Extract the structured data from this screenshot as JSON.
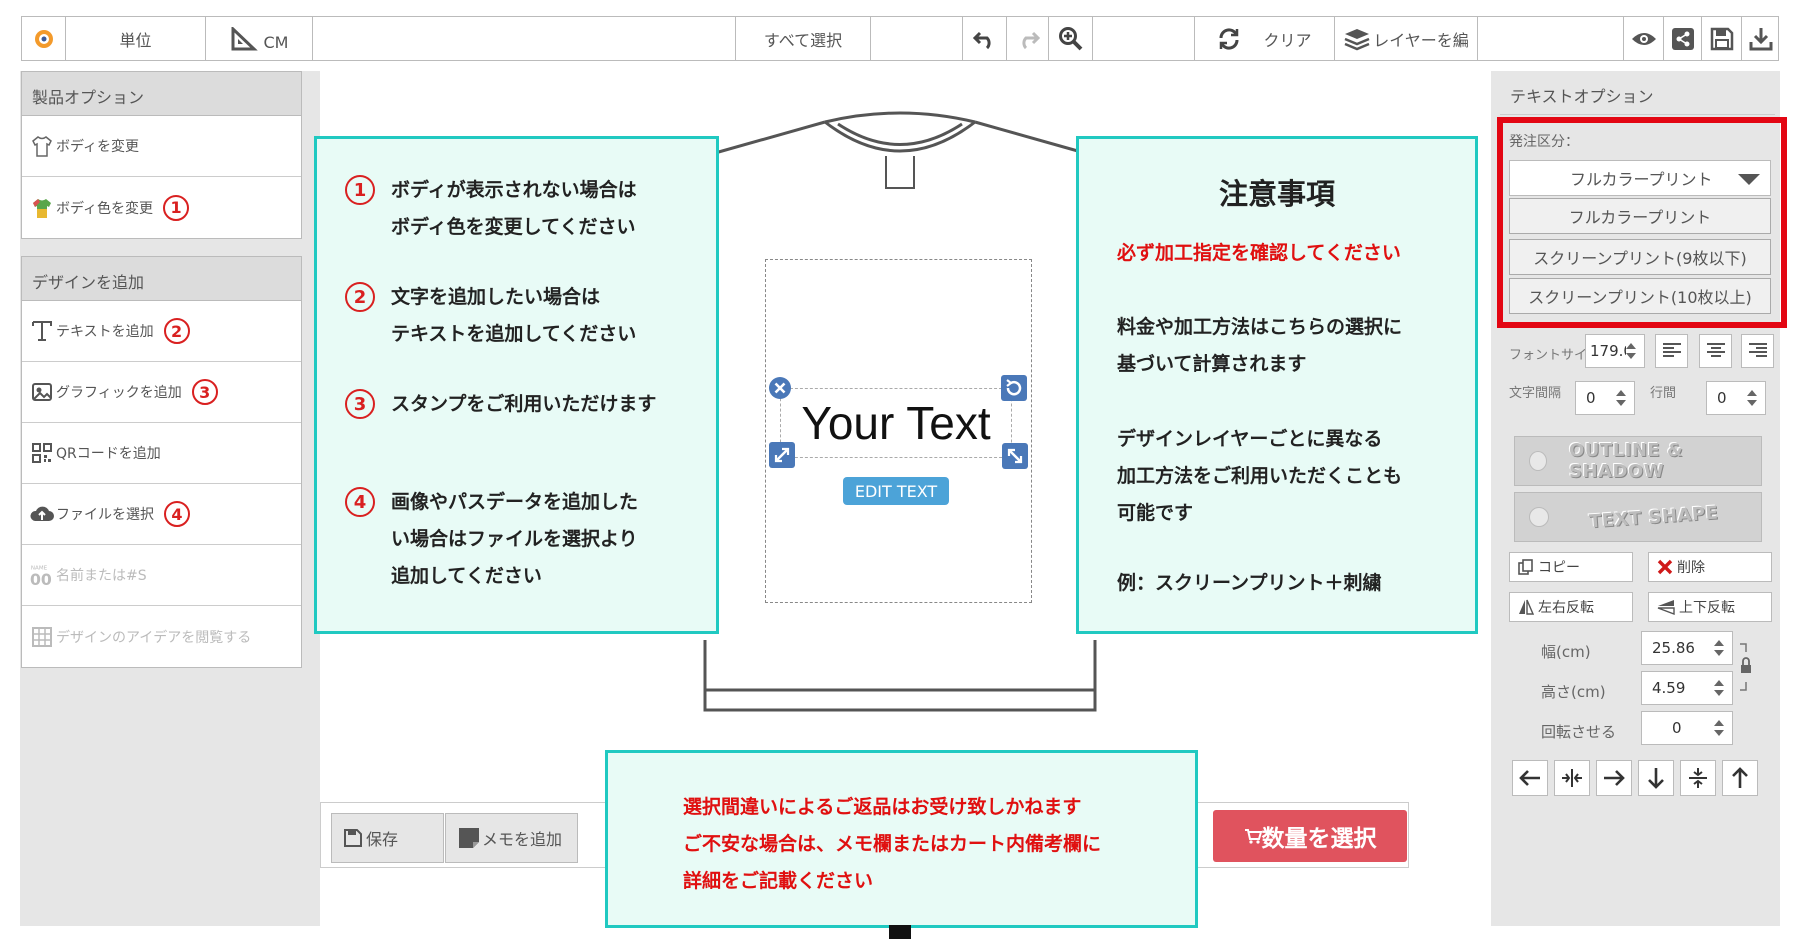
{
  "toolbar": {
    "unit_label": "単位",
    "unit_value": "CM",
    "select_all": "すべて選択",
    "clear": "クリア",
    "layers": "レイヤーを編"
  },
  "left_panel": {
    "product_options": {
      "title": "製品オプション",
      "items": [
        {
          "label": "ボディを変更",
          "icon": "tshirt-outline-icon"
        },
        {
          "label": "ボディ色を変更",
          "icon": "tshirt-color-icon",
          "number": "1"
        }
      ]
    },
    "add_design": {
      "title": "デザインを追加",
      "items": [
        {
          "label": "テキストを追加",
          "icon": "text-t-icon",
          "number": "2"
        },
        {
          "label": "グラフィックを追加",
          "icon": "graphic-icon",
          "number": "3"
        },
        {
          "label": "QRコードを追加",
          "icon": "qr-code-icon"
        },
        {
          "label": "ファイルを選択",
          "icon": "cloud-upload-icon",
          "number": "4"
        },
        {
          "label": "名前または#S",
          "icon": "name-number-icon",
          "disabled": true
        },
        {
          "label": "デザインのアイデアを閲覧する",
          "icon": "grid-icon",
          "disabled": true
        }
      ]
    }
  },
  "howto": [
    {
      "number": "1",
      "text": "ボディが表示されない場合は\nボディ色を変更してください"
    },
    {
      "number": "2",
      "text": "文字を追加したい場合は\nテキストを追加してください"
    },
    {
      "number": "3",
      "text": "スタンプをご利用いただけます"
    },
    {
      "number": "4",
      "text": "画像やパスデータを追加した\nい場合はファイルを選択より\n追加してください"
    }
  ],
  "notes": {
    "title": "注意事項",
    "warning": "必ず加工指定を確認してください",
    "p1": "料金や加工方法はこちらの選択に\n基づいて計算されます",
    "p2": "デザインレイヤーごとに異なる\n加工方法をご利用いただくことも\n可能です",
    "p3": "例：スクリーンプリント＋刺繍"
  },
  "returns_notice": "選択間違いによるご返品はお受け致しかねます\nご不安な場合は、メモ欄またはカート内備考欄に\n詳細をご記載ください",
  "canvas": {
    "text": "Your Text",
    "edit_button": "EDIT TEXT"
  },
  "bottom": {
    "save": "保存",
    "memo": "メモを追加",
    "quantity": "数量を選択"
  },
  "right_panel": {
    "title": "テキストオプション",
    "order_label": "発注区分：",
    "order_selected": "フルカラープリント",
    "order_options": [
      "フルカラープリント",
      "スクリーンプリント(9枚以下)",
      "スクリーンプリント(10枚以上)"
    ],
    "font_size_label": "フォントサイ",
    "font_size_value": "179.0",
    "letter_spacing_label": "文字間隔",
    "letter_spacing_value": "0",
    "line_height_label": "行間",
    "line_height_value": "0",
    "outline_shadow": "OUTLINE & SHADOW",
    "text_shape": "TEXT SHAPE",
    "copy": "コピー",
    "delete": "削除",
    "flip_h": "左右反転",
    "flip_v": "上下反転",
    "width_label": "幅(cm)",
    "width_value": "25.86",
    "height_label": "高さ(cm)",
    "height_value": "4.59",
    "rotate_label": "回転させる",
    "rotate_value": "0"
  },
  "colors": {
    "callout_border": "#20c9c1",
    "callout_bg": "#e8fbf6",
    "alert_red": "#e01010",
    "quantity_btn": "#e0535e",
    "edit_btn": "#4ca3d8",
    "handle_blue": "#4a78b8",
    "highlight_box": "#e30613"
  }
}
